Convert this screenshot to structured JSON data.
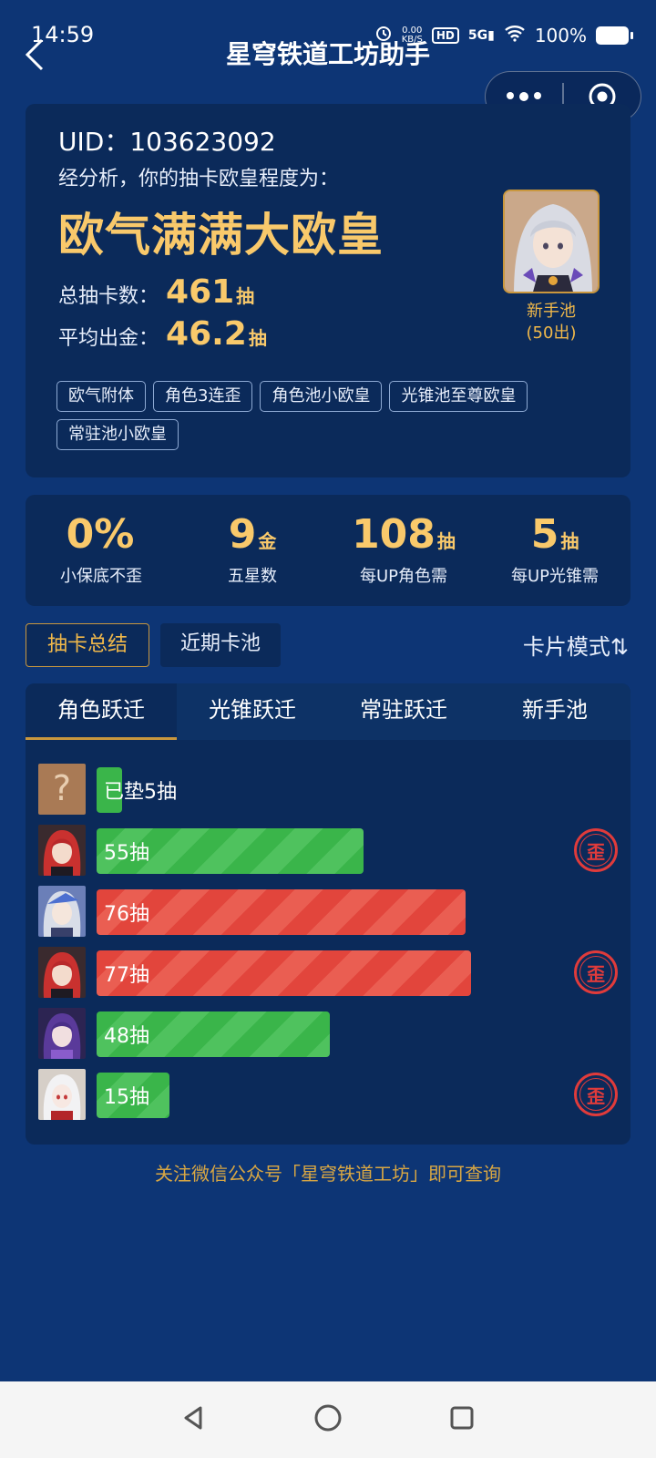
{
  "status_bar": {
    "time": "14:59",
    "net_speed": "0.00",
    "net_unit": "KB/S",
    "hd": "HD",
    "signal": "5G",
    "battery": "100%"
  },
  "header": {
    "title": "星穹铁道工坊助手"
  },
  "summary": {
    "uid": "UID：103623092",
    "analysis_text": "经分析，你的抽卡欧皇程度为：",
    "rank": "欧气满满大欧皇",
    "total_label": "总抽卡数：",
    "total_value": "461",
    "total_unit": "抽",
    "avg_label": "平均出金：",
    "avg_value": "46.2",
    "avg_unit": "抽",
    "pool_name": "新手池",
    "pool_note": "(50出)",
    "tags": [
      "欧气附体",
      "角色3连歪",
      "角色池小欧皇",
      "光锥池至尊欧皇",
      "常驻池小欧皇"
    ]
  },
  "stats": [
    {
      "value": "0%",
      "unit": "",
      "label": "小保底不歪"
    },
    {
      "value": "9",
      "unit": "金",
      "label": "五星数"
    },
    {
      "value": "108",
      "unit": "抽",
      "label": "每UP角色需"
    },
    {
      "value": "5",
      "unit": "抽",
      "label": "每UP光锥需"
    }
  ],
  "segments": {
    "summary": "抽卡总结",
    "recent": "近期卡池",
    "mode": "卡片模式⇅"
  },
  "tabs": [
    "角色跃迁",
    "光锥跃迁",
    "常驻跃迁",
    "新手池"
  ],
  "history": [
    {
      "label": "已垫5抽",
      "pulls": 5,
      "status": "pending",
      "lost": false,
      "avatar": "unknown"
    },
    {
      "label": "55抽",
      "pulls": 55,
      "status": "green",
      "lost": true,
      "avatar": "red-hair"
    },
    {
      "label": "76抽",
      "pulls": 76,
      "status": "red",
      "lost": false,
      "avatar": "silver-hair"
    },
    {
      "label": "77抽",
      "pulls": 77,
      "status": "red",
      "lost": true,
      "avatar": "red-hair"
    },
    {
      "label": "48抽",
      "pulls": 48,
      "status": "green",
      "lost": false,
      "avatar": "purple-hair"
    },
    {
      "label": "15抽",
      "pulls": 15,
      "status": "green",
      "lost": true,
      "avatar": "white-hair"
    }
  ],
  "lost_badge": "歪",
  "footer_note": "关注微信公众号「星穹铁道工坊」即可查询",
  "colors": {
    "background": "#0d3575",
    "card": "#0b2a5a",
    "gold": "#f9c96b",
    "green": "#3ab54a",
    "red": "#e2453c"
  }
}
